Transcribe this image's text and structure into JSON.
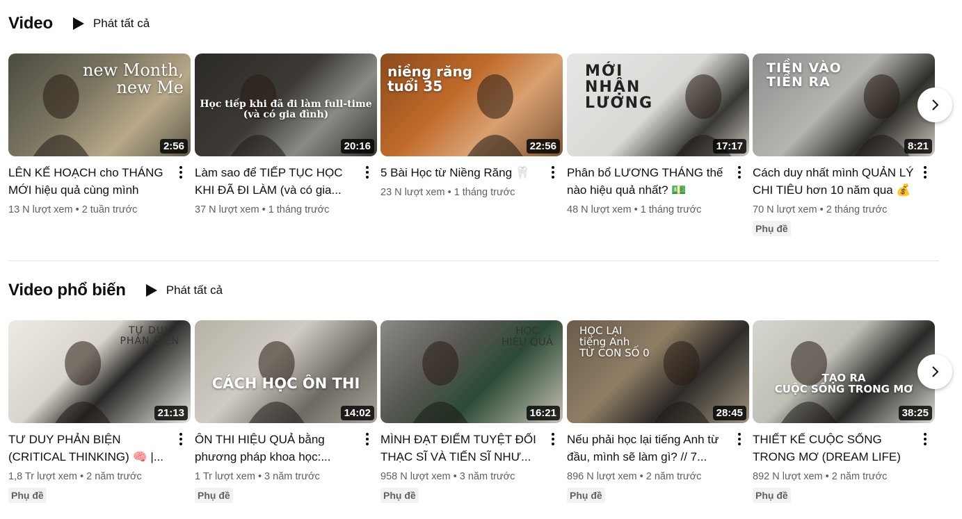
{
  "shelves": [
    {
      "title": "Video",
      "play_all": "Phát tất cả",
      "videos": [
        {
          "title": "LÊN KẾ HOẠCH cho THÁNG MỚI hiệu quả cùng mình",
          "duration": "2:56",
          "views": "13 N lượt xem",
          "age": "2 tuần trước",
          "thumb_text": "new Month,\nnew Me",
          "bg": "linear-gradient(135deg,#4a4a40 0%,#7a7560 40%,#b8a889 70%,#5c5a48 100%)",
          "badge": ""
        },
        {
          "title": "Làm sao để TIẾP TỤC HỌC KHI ĐÃ ĐI LÀM (và có gia...",
          "duration": "20:16",
          "views": "37 N lượt xem",
          "age": "1 tháng trước",
          "thumb_text": "Học tiếp khi đã đi làm full-time\n(và có gia đình)",
          "bg": "linear-gradient(135deg,#2c2a27 0%,#3d3a35 45%,#8a8a86 70%,#36332e 100%)",
          "badge": ""
        },
        {
          "title": "5 Bài Học từ Niềng Răng 🦷",
          "duration": "22:56",
          "views": "23 N lượt xem",
          "age": "1 tháng trước",
          "thumb_text": "niềng răng\ntuổi 35",
          "bg": "linear-gradient(135deg,#8b4a1c 0%,#c06a2a 40%,#d9a070 65%,#7c5535 100%)",
          "badge": ""
        },
        {
          "title": "Phân bổ LƯƠNG THÁNG thế nào hiệu quả nhất? 💵",
          "duration": "17:17",
          "views": "48 N lượt xem",
          "age": "1 tháng trước",
          "thumb_text": "MỚI\nNHẬN\nLƯƠNG",
          "bg": "linear-gradient(135deg,#e6e6e4 0%,#d8d8d5 50%,#3a3835 75%,#ccc8c0 100%)",
          "badge": ""
        },
        {
          "title": "Cách duy nhất mình QUẢN LÝ CHI TIÊU hơn 10 năm qua 💰",
          "duration": "8:21",
          "views": "70 N lượt xem",
          "age": "2 tháng trước",
          "thumb_text": "TIỀN VÀO\nTIỀN RA",
          "bg": "linear-gradient(135deg,#8d8f8d 0%,#b5b5b0 45%,#2f2d2a 70%,#cfcac0 100%)",
          "badge": "Phụ đề"
        }
      ]
    },
    {
      "title": "Video phổ biến",
      "play_all": "Phát tất cả",
      "videos": [
        {
          "title": "TƯ DUY PHẢN BIỆN (CRITICAL THINKING) 🧠 |...",
          "duration": "21:13",
          "views": "1,8 Tr lượt xem",
          "age": "2 năm trước",
          "thumb_text": "TƯ DUY\nPHẢN BIỆN",
          "bg": "linear-gradient(135deg,#eceae4 0%,#d9d5cc 40%,#2c2a28 60%,#e8e6de 100%)",
          "badge": "Phụ đề"
        },
        {
          "title": "ÔN THI HIỆU QUẢ bằng phương pháp khoa học:...",
          "duration": "14:02",
          "views": "1 Tr lượt xem",
          "age": "3 năm trước",
          "thumb_text": "CÁCH HỌC ÔN THI",
          "bg": "linear-gradient(135deg,#b7b2a8 0%,#cfcbc2 40%,#6e6a63 70%,#a9a49a 100%)",
          "badge": "Phụ đề"
        },
        {
          "title": "MÌNH ĐẠT ĐIỂM TUYỆT ĐỐI THẠC SĨ VÀ TIẾN SĨ NHƯ...",
          "duration": "16:21",
          "views": "958 N lượt xem",
          "age": "3 năm trước",
          "thumb_text": "HỌC\nHIỆU QUẢ",
          "bg": "linear-gradient(135deg,#8c8a84 0%,#5a5853 35%,#2b4a35 60%,#c8c2b5 100%)",
          "badge": "Phụ đề"
        },
        {
          "title": "Nếu phải học lại tiếng Anh từ đầu, mình sẽ làm gì? // 7...",
          "duration": "28:45",
          "views": "896 N lượt xem",
          "age": "2 năm trước",
          "thumb_text": "HỌC LẠI\ntiếng Anh\nTỪ CON SỐ 0",
          "bg": "linear-gradient(135deg,#6b5c4a 0%,#8f7d65 40%,#2d2b28 65%,#a09480 100%)",
          "badge": "Phụ đề"
        },
        {
          "title": "THIẾT KẾ CUỘC SỐNG TRONG MƠ (DREAM LIFE) //...",
          "duration": "38:25",
          "views": "892 N lượt xem",
          "age": "2 năm trước",
          "thumb_text": "TẠO RA\nCUỘC SỐNG TRONG MƠ",
          "bg": "linear-gradient(135deg,#d6d6d0 0%,#bfbfb6 40%,#2a2826 65%,#dcdad2 100%)",
          "badge": "Phụ đề"
        }
      ]
    }
  ],
  "icons": {
    "play": "play-icon",
    "more": "more-vert-icon",
    "next": "chevron-right-icon"
  }
}
